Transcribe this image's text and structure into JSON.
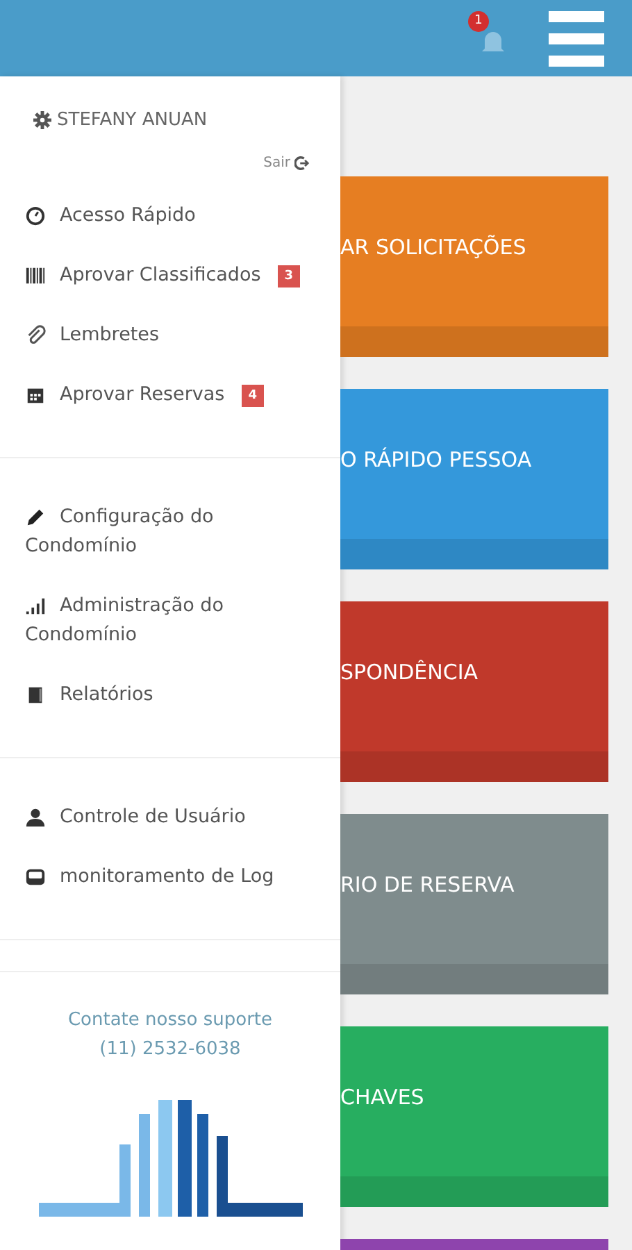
{
  "header": {
    "notification_count": "1"
  },
  "drawer": {
    "user_name": "STEFANY ANUAN",
    "logout": "Sair",
    "sections": [
      {
        "items": [
          {
            "label": "Acesso Rápido",
            "kind": "clock"
          },
          {
            "label": "Aprovar Classificados",
            "kind": "barcode",
            "badge": "3"
          },
          {
            "label": "Lembretes",
            "kind": "paperclip"
          },
          {
            "label": "Aprovar Reservas",
            "kind": "calendar",
            "badge": "4"
          }
        ]
      },
      {
        "items": [
          {
            "label": "Configuração do Condomínio",
            "kind": "pencil"
          },
          {
            "label": "Administração do Condomínio",
            "kind": "signal"
          },
          {
            "label": "Relatórios",
            "kind": "book"
          }
        ]
      },
      {
        "items": [
          {
            "label": "Controle de Usuário",
            "kind": "user"
          },
          {
            "label": "monitoramento de Log",
            "kind": "monitor"
          }
        ]
      }
    ],
    "support": {
      "text": "Contate nosso suporte",
      "phone": "(11) 2532-6038"
    }
  },
  "tiles": [
    {
      "label": "AR SOLICITAÇÕES",
      "color": "#e67e22"
    },
    {
      "label": "O RÁPIDO PESSOA",
      "color": "#3498db"
    },
    {
      "label": "SPONDÊNCIA",
      "color": "#c0392b"
    },
    {
      "label": "RIO DE RESERVA",
      "color": "#7f8c8d"
    },
    {
      "label": "CHAVES",
      "color": "#27ae60"
    },
    {
      "color": "#8e44ad"
    }
  ]
}
